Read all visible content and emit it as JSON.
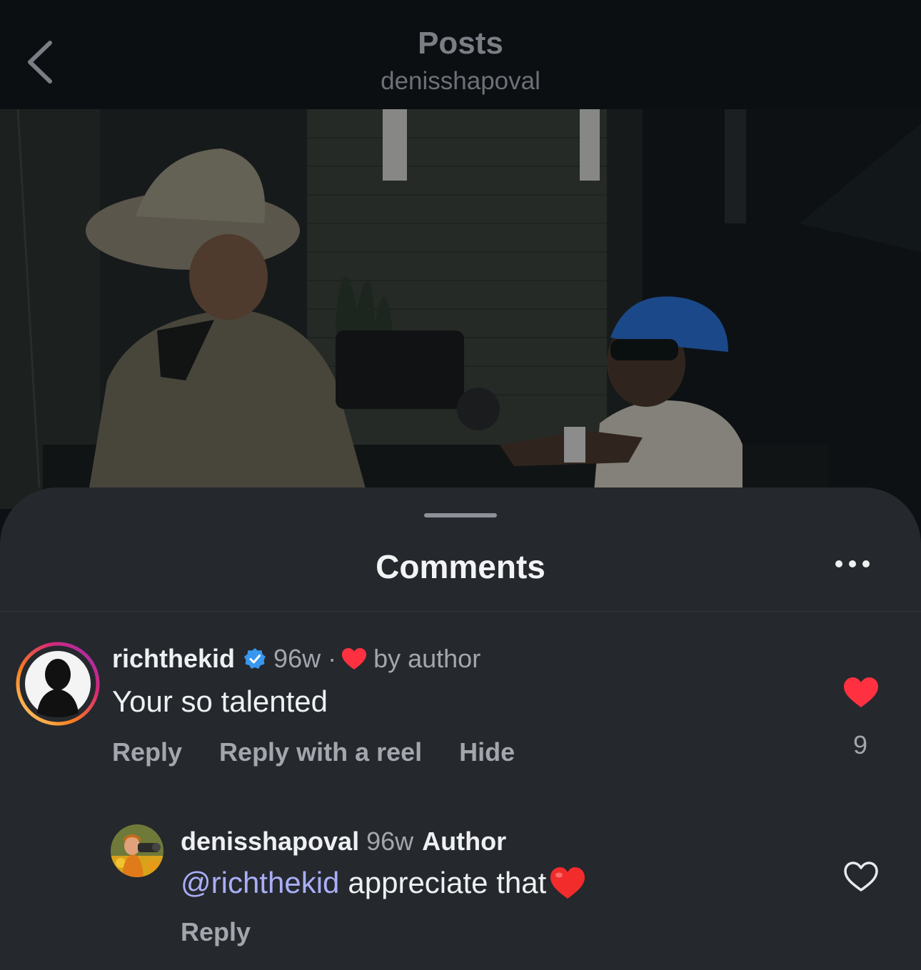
{
  "header": {
    "title": "Posts",
    "subtitle": "denisshapoval"
  },
  "sheet": {
    "title": "Comments"
  },
  "comments": [
    {
      "username": "richthekid",
      "verified": true,
      "age": "96w",
      "separator": "·",
      "liked_by_author_label": "by author",
      "text": "Your so talented",
      "actions": [
        "Reply",
        "Reply with a reel",
        "Hide"
      ],
      "like_count": "9",
      "liked": true
    },
    {
      "username": "denisshapoval",
      "age": "96w",
      "badge": "Author",
      "mention": "@richthekid",
      "text": "appreciate that",
      "actions": [
        "Reply"
      ],
      "liked": false
    }
  ],
  "colors": {
    "background": "#0d1014",
    "sheet": "#25282d",
    "like_red": "#ff3040",
    "mention": "#a9aef7",
    "verified_blue": "#3897f0"
  },
  "icons": [
    "chevron-left-icon",
    "more-horizontal-icon",
    "verified-badge-icon",
    "heart-icon",
    "heart-outline-icon"
  ]
}
